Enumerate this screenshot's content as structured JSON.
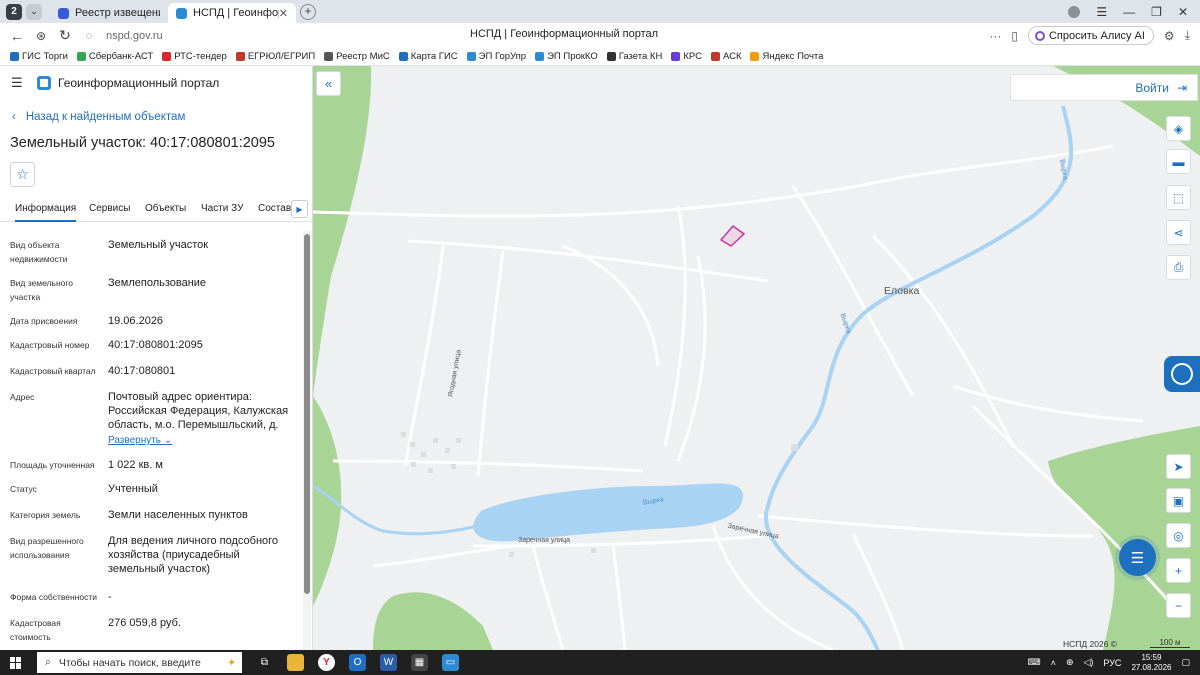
{
  "browser": {
    "tab_count": "2",
    "tabs": [
      {
        "label": "Реестр извещений",
        "favicon_color": "#3a5bd9"
      },
      {
        "label": "НСПД | Геоинформацио",
        "favicon_color": "#2d8bd3"
      }
    ],
    "new_tab": "+",
    "url": "nspd.gov.ru",
    "page_title": "НСПД | Геоинформационный портал",
    "alice_label": "Спросить Алису AI",
    "bookmarks": [
      {
        "label": "ГИС Торги",
        "color": "#1f6fbf"
      },
      {
        "label": "Сбербанк-АСТ",
        "color": "#2fa84f"
      },
      {
        "label": "РТС-тендер",
        "color": "#d62b2b"
      },
      {
        "label": "ЕГРЮЛ/ЕГРИП",
        "color": "#c0392b"
      },
      {
        "label": "Реестр МиС",
        "color": "#555555"
      },
      {
        "label": "Карта ГИС",
        "color": "#1f6fbf"
      },
      {
        "label": "ЭП ГорУпр",
        "color": "#2d8bd3"
      },
      {
        "label": "ЭП ПрокКО",
        "color": "#2d8bd3"
      },
      {
        "label": "Газета КН",
        "color": "#333333"
      },
      {
        "label": "КРС",
        "color": "#6a3bd6"
      },
      {
        "label": "АСК",
        "color": "#c0392b"
      },
      {
        "label": "Яндекс Почта",
        "color": "#f39c12"
      }
    ]
  },
  "panel": {
    "portal_name": "Геоинформационный портал",
    "back_label": "Назад к найденным объектам",
    "object_title": "Земельный участок: 40:17:080801:2095",
    "tabs": [
      "Информация",
      "Сервисы",
      "Объекты",
      "Части ЗУ",
      "Состав"
    ],
    "attributes": [
      {
        "label": "Вид объекта недвижимости",
        "value": "Земельный участок"
      },
      {
        "label": "Вид земельного участка",
        "value": "Землепользование"
      },
      {
        "label": "Дата присвоения",
        "value": "19.06.2026"
      },
      {
        "label": "Кадастровый номер",
        "value": "40:17:080801:2095"
      },
      {
        "label": "Кадастровый квартал",
        "value": "40:17:080801"
      },
      {
        "label": "Адрес",
        "value": "Почтовый адрес ориентира: Российская Федерация, Калужская область, м.о. Перемышльский, д."
      },
      {
        "label": "Площадь уточненная",
        "value": "1 022 кв. м"
      },
      {
        "label": "Статус",
        "value": "Учтенный"
      },
      {
        "label": "Категория земель",
        "value": "Земли населенных пунктов"
      },
      {
        "label": "Вид разрешенного использования",
        "value": "Для ведения личного подсобного хозяйства (приусадебный земельный участок)"
      },
      {
        "label": "Форма собственности",
        "value": "-"
      },
      {
        "label": "Кадастровая стоимость",
        "value": "276 059,8 руб."
      }
    ],
    "expand_label": "Развернуть"
  },
  "map": {
    "login_label": "Войти",
    "labels": {
      "village": "Еловка",
      "river1": "Вырка",
      "river2": "Вырка",
      "river3": "Вырка",
      "street1": "Ягодная улица",
      "street2": "Заречная улица",
      "street3": "Заречная улица"
    },
    "attribution": "НСПД 2026 ©",
    "scale": "100 м",
    "water_color": "#a9d3f2",
    "forest_color": "#a8d596",
    "parcel_color": "#c2359b"
  },
  "taskbar": {
    "search_placeholder": "Чтобы начать поиск, введите",
    "lang": "РУС",
    "time": "15:59",
    "date": "27.08.2026"
  }
}
